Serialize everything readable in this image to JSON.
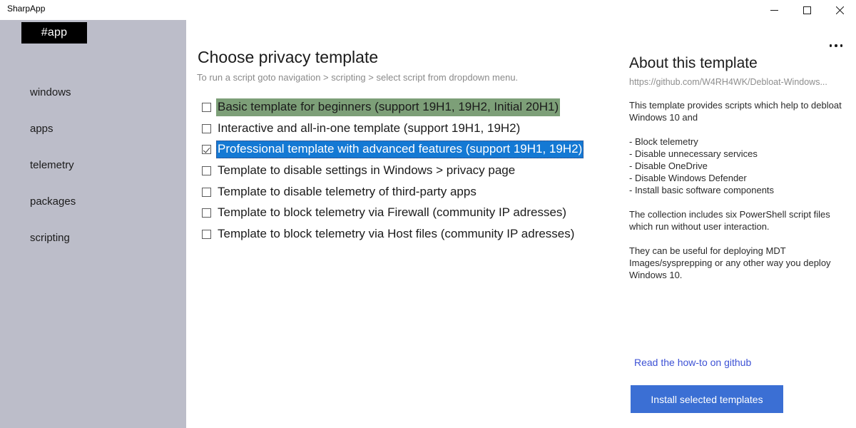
{
  "window": {
    "title": "SharpApp",
    "controls": [
      {
        "name": "minimize",
        "glyph": "minimize"
      },
      {
        "name": "maximize",
        "glyph": "maximize"
      },
      {
        "name": "close",
        "glyph": "close"
      }
    ]
  },
  "sidebar": {
    "app_tab_label": "#app",
    "items": [
      {
        "label": "windows"
      },
      {
        "label": "apps"
      },
      {
        "label": "telemetry"
      },
      {
        "label": "packages"
      },
      {
        "label": "scripting"
      }
    ]
  },
  "main": {
    "title": "Choose privacy template",
    "subtitle": "To run a script goto navigation > scripting > select script from dropdown menu.",
    "overflow_menu_icon": "ellipsis-horizontal-icon",
    "templates": [
      {
        "label": "Basic template for beginners (support 19H1, 19H2, Initial 20H1)",
        "checked": false,
        "state": "hovered"
      },
      {
        "label": "Interactive and all-in-one template (support 19H1, 19H2)",
        "checked": false,
        "state": "normal"
      },
      {
        "label": "Professional template with advanced features (support 19H1, 19H2)",
        "checked": true,
        "state": "selected"
      },
      {
        "label": "Template to disable settings in Windows > privacy page",
        "checked": false,
        "state": "normal"
      },
      {
        "label": "Template to disable telemetry of third-party apps",
        "checked": false,
        "state": "normal"
      },
      {
        "label": "Template to block telemetry via Firewall (community IP adresses)",
        "checked": false,
        "state": "normal"
      },
      {
        "label": "Template to block telemetry via Host files (community IP adresses)",
        "checked": false,
        "state": "normal"
      }
    ]
  },
  "info": {
    "title": "About this template",
    "url": "https://github.com/W4RH4WK/Debloat-Windows...",
    "description": "This template provides scripts which help to debloat Windows 10 and",
    "features": [
      "- Block telemetry",
      "- Disable unnecessary services",
      "- Disable OneDrive",
      "- Disable Windows Defender",
      "- Install basic software components"
    ],
    "paragraph2": "The collection includes six PowerShell script files which run without user interaction.",
    "paragraph3": "They can be useful for deploying MDT Images/sysprepping or any other way you deploy Windows 10.",
    "link_label": "Read the how-to on github",
    "install_button_label": "Install selected templates"
  },
  "colors": {
    "sidebar_bg": "#bcbdc9",
    "hover_green": "#7d9f78",
    "selected_blue": "#1479d4",
    "link_blue": "#3d52d5",
    "button_blue": "#3b6fd4"
  }
}
